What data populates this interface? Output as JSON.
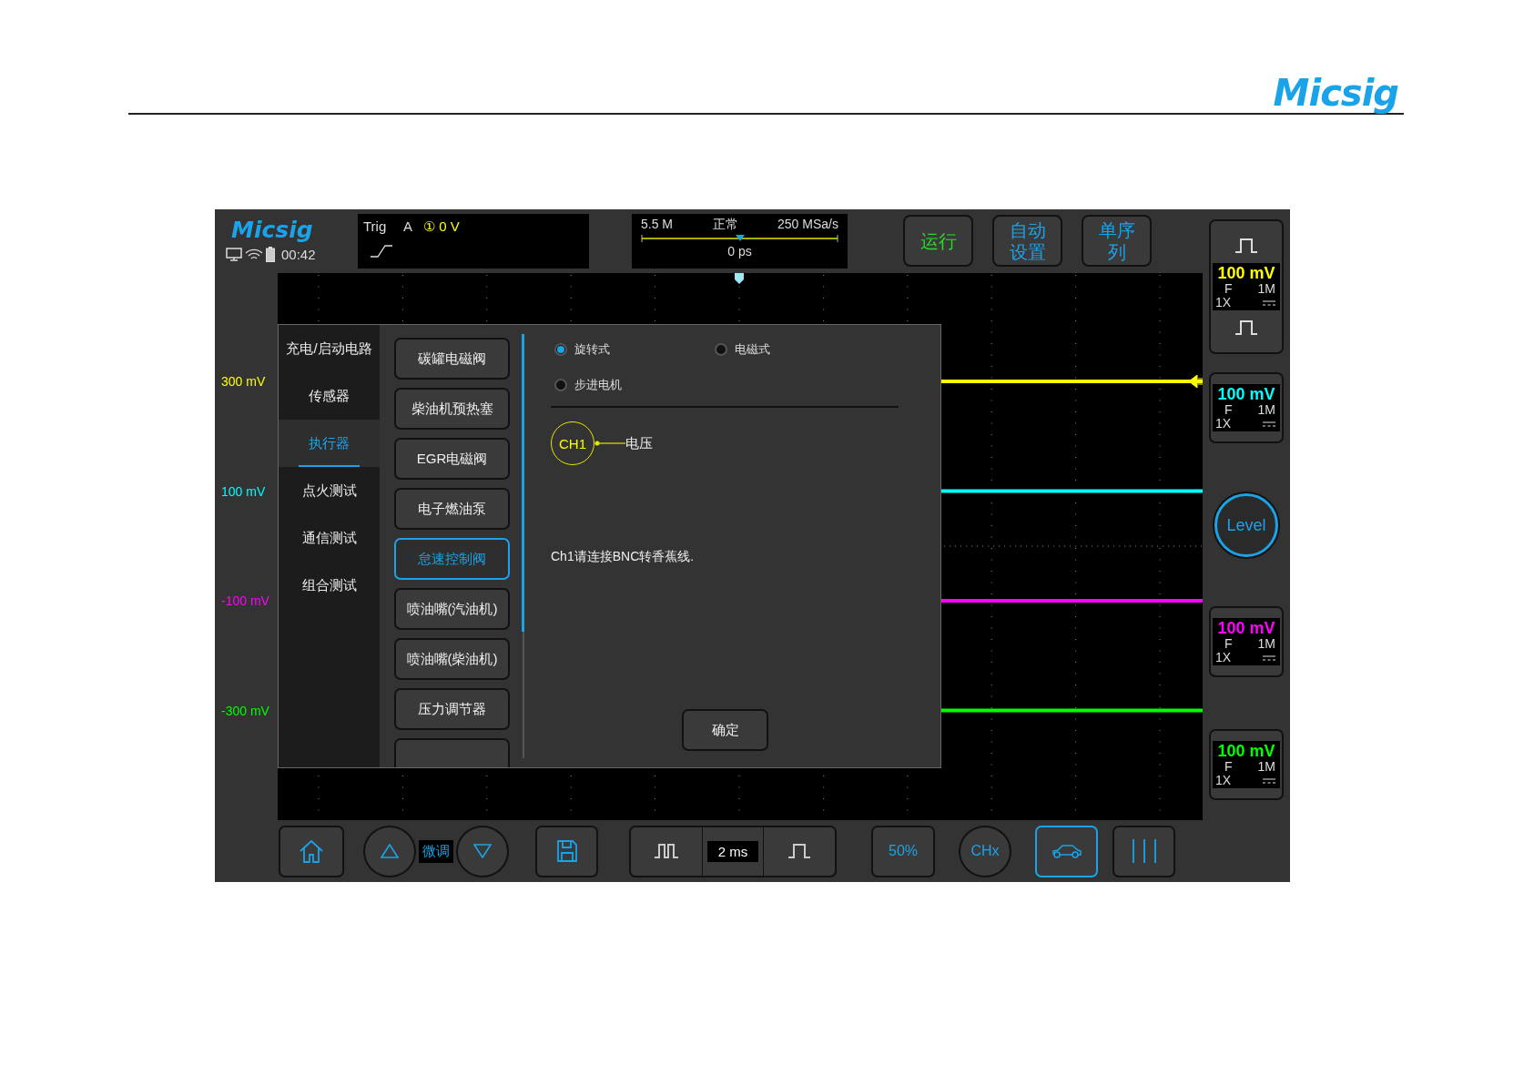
{
  "brand": {
    "logo": "Micsig"
  },
  "screen": {
    "logo": "Micsig",
    "clock": "00:42",
    "trigger": {
      "label": "Trig",
      "source": "A",
      "channel": "①",
      "level": "0 V"
    },
    "timebase": {
      "memory": "5.5 M",
      "mode": "正常",
      "sample_rate": "250 MSa/s",
      "position": "0 ps"
    },
    "top_buttons": [
      {
        "label": "运行",
        "color": "#22dd22"
      },
      {
        "label": "自动设置",
        "color": "#1aa3e8"
      },
      {
        "label": "单序列",
        "color": "#1aa3e8"
      }
    ],
    "channels": [
      {
        "offset_label": "300 mV",
        "scale": "100 mV",
        "coupling": "F",
        "impedance": "1M",
        "probe": "1X",
        "color": "#ffff00"
      },
      {
        "offset_label": "100 mV",
        "scale": "100 mV",
        "coupling": "F",
        "impedance": "1M",
        "probe": "1X",
        "color": "#00ffff"
      },
      {
        "offset_label": "-100 mV",
        "scale": "100 mV",
        "coupling": "F",
        "impedance": "1M",
        "probe": "1X",
        "color": "#ff00ff"
      },
      {
        "offset_label": "-300 mV",
        "scale": "100 mV",
        "coupling": "F",
        "impedance": "1M",
        "probe": "1X",
        "color": "#00ff00"
      }
    ],
    "level_button": "Level",
    "dialog": {
      "categories": [
        {
          "label": "充电/启动电路",
          "selected": false
        },
        {
          "label": "传感器",
          "selected": false
        },
        {
          "label": "执行器",
          "selected": true
        },
        {
          "label": "点火测试",
          "selected": false
        },
        {
          "label": "通信测试",
          "selected": false
        },
        {
          "label": "组合测试",
          "selected": false
        }
      ],
      "items": [
        {
          "label": "碳罐电磁阀",
          "selected": false
        },
        {
          "label": "柴油机预热塞",
          "selected": false
        },
        {
          "label": "EGR电磁阀",
          "selected": false
        },
        {
          "label": "电子燃油泵",
          "selected": false
        },
        {
          "label": "怠速控制阀",
          "selected": true
        },
        {
          "label": "喷油嘴(汽油机)",
          "selected": false
        },
        {
          "label": "喷油嘴(柴油机)",
          "selected": false
        },
        {
          "label": "压力调节器",
          "selected": false
        }
      ],
      "options": [
        {
          "label": "旋转式",
          "selected": true
        },
        {
          "label": "电磁式",
          "selected": false
        },
        {
          "label": "步进电机",
          "selected": false
        }
      ],
      "connection": {
        "channel": "CH1",
        "signal": "电压"
      },
      "instruction": "Ch1请连接BNC转香蕉线.",
      "confirm": "确定"
    },
    "bottom_buttons": [
      {
        "kind": "home",
        "selected": false
      },
      {
        "kind": "up",
        "selected": false
      },
      {
        "kind": "fine",
        "label": "微调",
        "selected": false
      },
      {
        "kind": "down",
        "selected": false
      },
      {
        "kind": "save",
        "selected": false
      },
      {
        "kind": "timebase",
        "label": "2 ms",
        "selected": false
      },
      {
        "kind": "text",
        "label": "50%",
        "selected": false
      },
      {
        "kind": "circle",
        "label": "CHx",
        "selected": false
      },
      {
        "kind": "car",
        "selected": true
      },
      {
        "kind": "bars",
        "selected": false
      }
    ]
  }
}
